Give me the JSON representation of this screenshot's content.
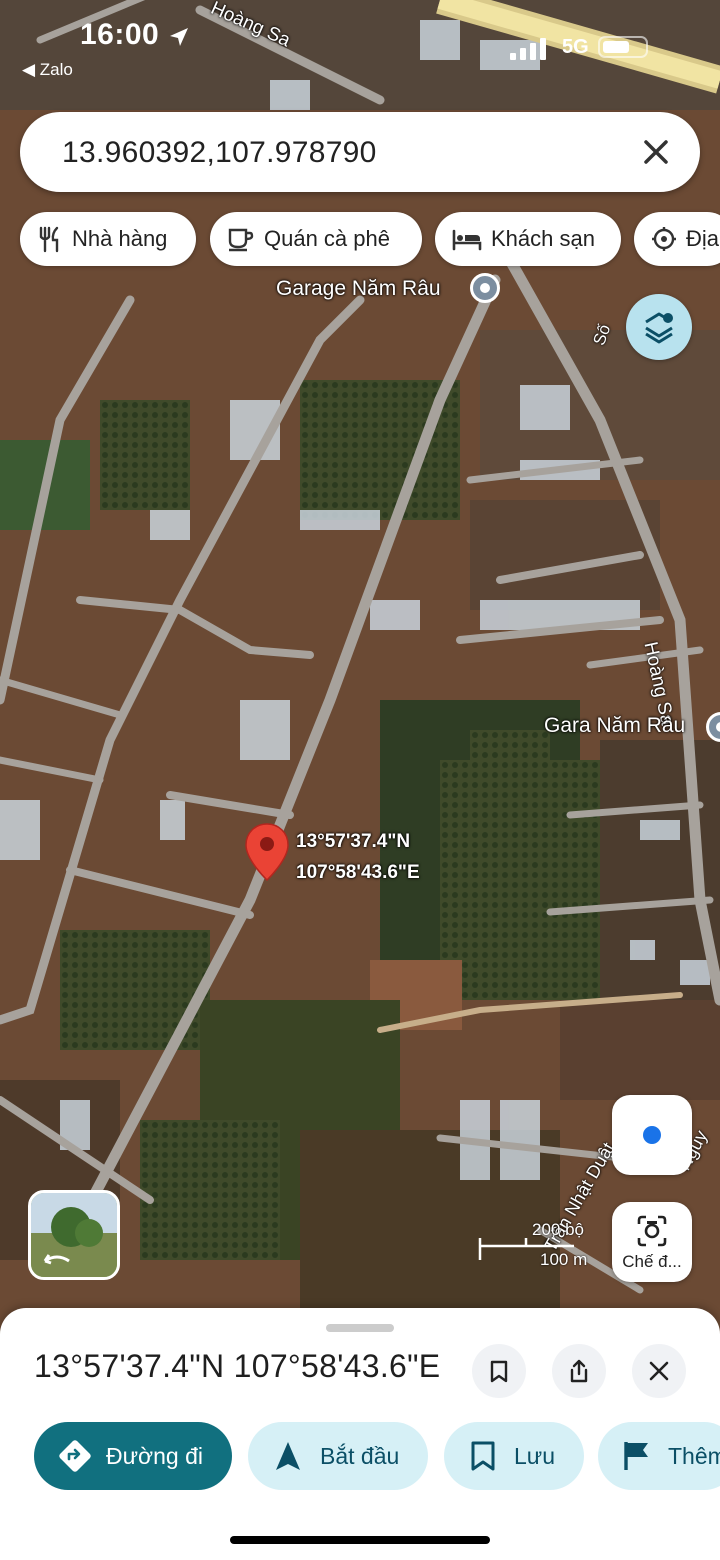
{
  "status_bar": {
    "time": "16:00",
    "back_app": "◀ Zalo",
    "network": "5G"
  },
  "search": {
    "query": "13.960392,107.978790",
    "close_icon": "close-icon"
  },
  "category_chips": [
    {
      "label": "Nhà hàng",
      "icon": "restaurant-icon"
    },
    {
      "label": "Quán cà phê",
      "icon": "coffee-icon"
    },
    {
      "label": "Khách sạn",
      "icon": "hotel-icon"
    },
    {
      "label": "Địa",
      "icon": "attraction-icon"
    }
  ],
  "map": {
    "street_labels": [
      "Hoàng Sa",
      "Hoàng Sa",
      "Số",
      "Trần Nhật Duật",
      "Nguy"
    ],
    "places": [
      "Garage Năm Râu",
      "Gara Năm Râu"
    ],
    "dropped_pin": {
      "lat_text": "13°57'37.4\"N",
      "lng_text": "107°58'43.6\"E"
    },
    "scale": {
      "feet": "200 bộ",
      "meters": "100 m"
    },
    "lens_label": "Chế đ...",
    "colors": {
      "pin": "#ea4335",
      "location_dot": "#1a73e8"
    }
  },
  "sheet": {
    "title": "13°57'37.4\"N 107°58'43.6\"E",
    "actions": [
      {
        "label": "Đường đi",
        "icon": "directions-icon",
        "primary": true
      },
      {
        "label": "Bắt đầu",
        "icon": "navigation-arrow-icon",
        "primary": false
      },
      {
        "label": "Lưu",
        "icon": "bookmark-icon",
        "primary": false
      },
      {
        "label": "Thêm",
        "icon": "flag-icon",
        "primary": false
      }
    ],
    "colors": {
      "primary_action": "#11707f",
      "secondary_action": "#d6f0f6"
    }
  }
}
